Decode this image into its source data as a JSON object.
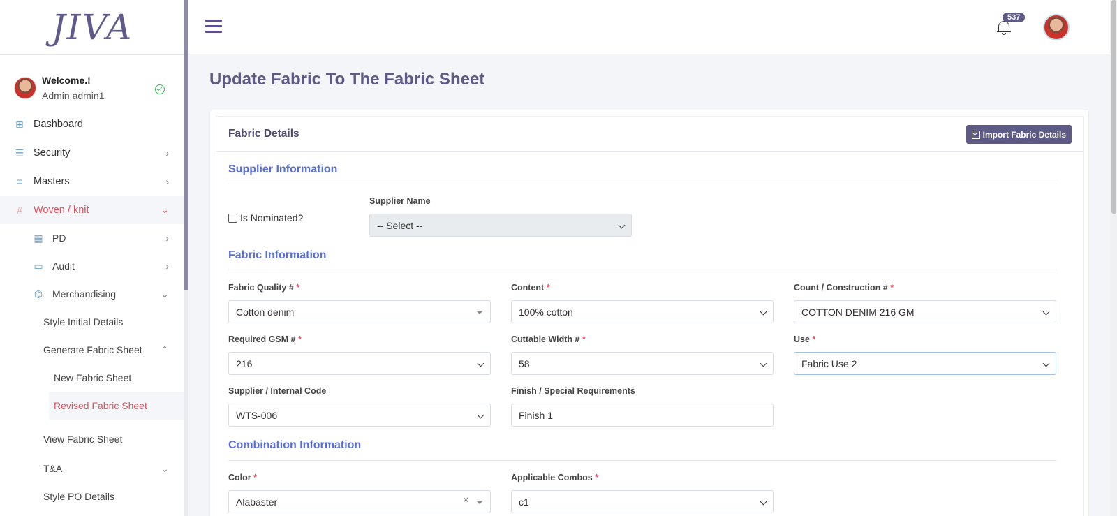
{
  "brand": {
    "logo_text": "JIVA"
  },
  "user": {
    "welcome": "Welcome.!",
    "name": "Admin admin1"
  },
  "sidebar": {
    "items": [
      {
        "label": "Dashboard",
        "icon": "dashboard-icon"
      },
      {
        "label": "Security",
        "icon": "sliders-icon"
      },
      {
        "label": "Masters",
        "icon": "masters-icon"
      },
      {
        "label": "Woven / knit",
        "icon": "grid-icon"
      },
      {
        "label": "PD",
        "icon": "table-icon"
      },
      {
        "label": "Audit",
        "icon": "audit-icon"
      },
      {
        "label": "Merchandising",
        "icon": "merch-icon"
      },
      {
        "label": "Style Initial Details"
      },
      {
        "label": "Generate Fabric Sheet"
      },
      {
        "label": "New Fabric Sheet"
      },
      {
        "label": "Revised Fabric Sheet"
      },
      {
        "label": "View Fabric Sheet"
      },
      {
        "label": "T&A"
      },
      {
        "label": "Style PO Details"
      }
    ]
  },
  "topbar": {
    "notification_count": "537"
  },
  "page": {
    "title": "Update Fabric To The Fabric Sheet"
  },
  "card": {
    "title": "Fabric Details",
    "import_label": "Import Fabric Details"
  },
  "supplier": {
    "section_title": "Supplier Information",
    "nominated_label": "Is Nominated?",
    "name_label": "Supplier Name",
    "name_value": "-- Select --"
  },
  "fabric": {
    "section_title": "Fabric Information",
    "quality_label": "Fabric Quality #",
    "quality_value": "Cotton denim",
    "content_label": "Content",
    "content_value": "100% cotton",
    "count_label": "Count / Construction #",
    "count_value": "COTTON DENIM 216 GM",
    "gsm_label": "Required GSM #",
    "gsm_value": "216",
    "width_label": "Cuttable Width #",
    "width_value": "58",
    "use_label": "Use",
    "use_value": "Fabric Use 2",
    "code_label": "Supplier / Internal Code",
    "code_value": "WTS-006",
    "finish_label": "Finish / Special Requirements",
    "finish_value": "Finish 1",
    "required_mark": "*"
  },
  "combination": {
    "section_title": "Combination Information",
    "color_label": "Color",
    "color_value": "Alabaster",
    "clear_symbol": "×",
    "combos_label": "Applicable Combos",
    "combos_value": "c1"
  }
}
